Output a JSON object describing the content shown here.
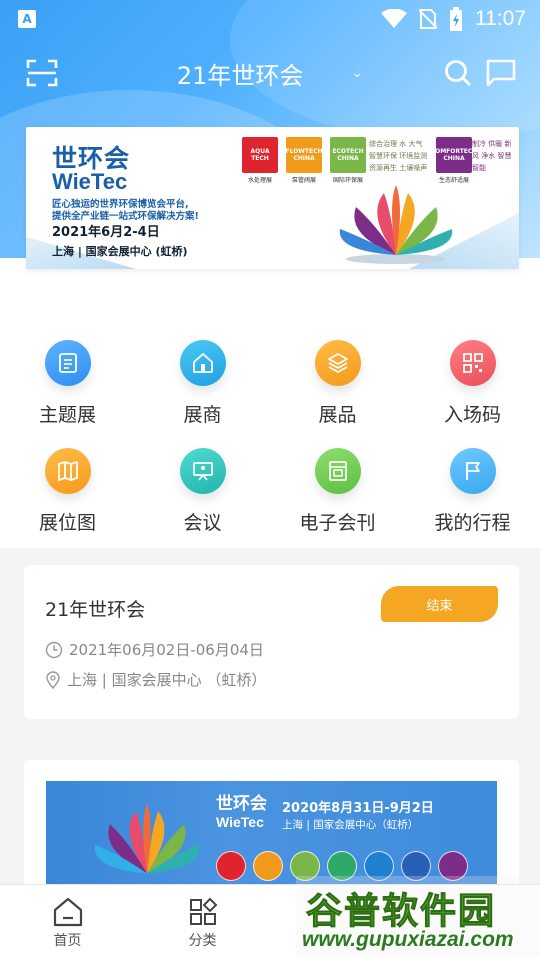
{
  "status_bar": {
    "app_badge": "A",
    "time": "11:07"
  },
  "top_bar": {
    "title": "21年世环会",
    "dropdown_arrow": "⌄"
  },
  "banner": {
    "brand_cn": "世环会",
    "brand_en": "WieTec",
    "slogan_line1": "匠心独运的世界环保博览会平台,",
    "slogan_line2": "提供全产业链一站式环保解决方案!",
    "dates": "2021年6月2-4日",
    "venue": "上海 | 国家会展中心 (虹桥)",
    "logos": [
      {
        "mark": "AQUA TECH",
        "caption": "水处理展",
        "color": "#e0242e"
      },
      {
        "mark": "FLOWTECH CHINA",
        "caption": "泵管阀展",
        "color": "#f29a1c"
      },
      {
        "mark": "ECOTECH CHINA",
        "caption": "国际环保展",
        "color": "#7ab648"
      },
      {
        "mark": "COMFORTECH CHINA",
        "caption": "生态舒适展",
        "color": "#7b2d87"
      }
    ],
    "tags_green": "综合治理 水 大气 智慧环保 环境监测 资源再生 土壤噪声",
    "tags_purple": "制冷 供暖 新风 净水 智慧智能"
  },
  "grid": [
    {
      "label": "主题展",
      "icon": "document-icon",
      "color": "#3b9cf0"
    },
    {
      "label": "展商",
      "icon": "building-icon",
      "color": "#2fb0e8"
    },
    {
      "label": "展品",
      "icon": "box-icon",
      "color": "#f7a22a"
    },
    {
      "label": "入场码",
      "icon": "qrcode-icon",
      "color": "#f1646a"
    },
    {
      "label": "展位图",
      "icon": "map-icon",
      "color": "#f9a62b"
    },
    {
      "label": "会议",
      "icon": "presentation-icon",
      "color": "#35c6c0"
    },
    {
      "label": "电子会刊",
      "icon": "magazine-icon",
      "color": "#6fcf57"
    },
    {
      "label": "我的行程",
      "icon": "flag-icon",
      "color": "#4fb7f0"
    }
  ],
  "event_card": {
    "title": "21年世环会",
    "status": "结束",
    "date_range": "2021年06月02日-06月04日",
    "venue": "上海 | 国家会展中心 （虹桥）"
  },
  "banner2": {
    "brand_cn": "世环会",
    "brand_en": "WieTec",
    "dates": "2020年8月31日-9月2日",
    "venue": "上海 | 国家会展中心（虹桥）"
  },
  "bottom_nav": [
    {
      "label": "首页",
      "icon": "home-icon"
    },
    {
      "label": "分类",
      "icon": "category-icon"
    },
    {
      "label": "",
      "icon": ""
    },
    {
      "label": "",
      "icon": ""
    }
  ],
  "watermark": {
    "cn": "谷普软件园",
    "url": "www.gupuxiazai.com"
  }
}
